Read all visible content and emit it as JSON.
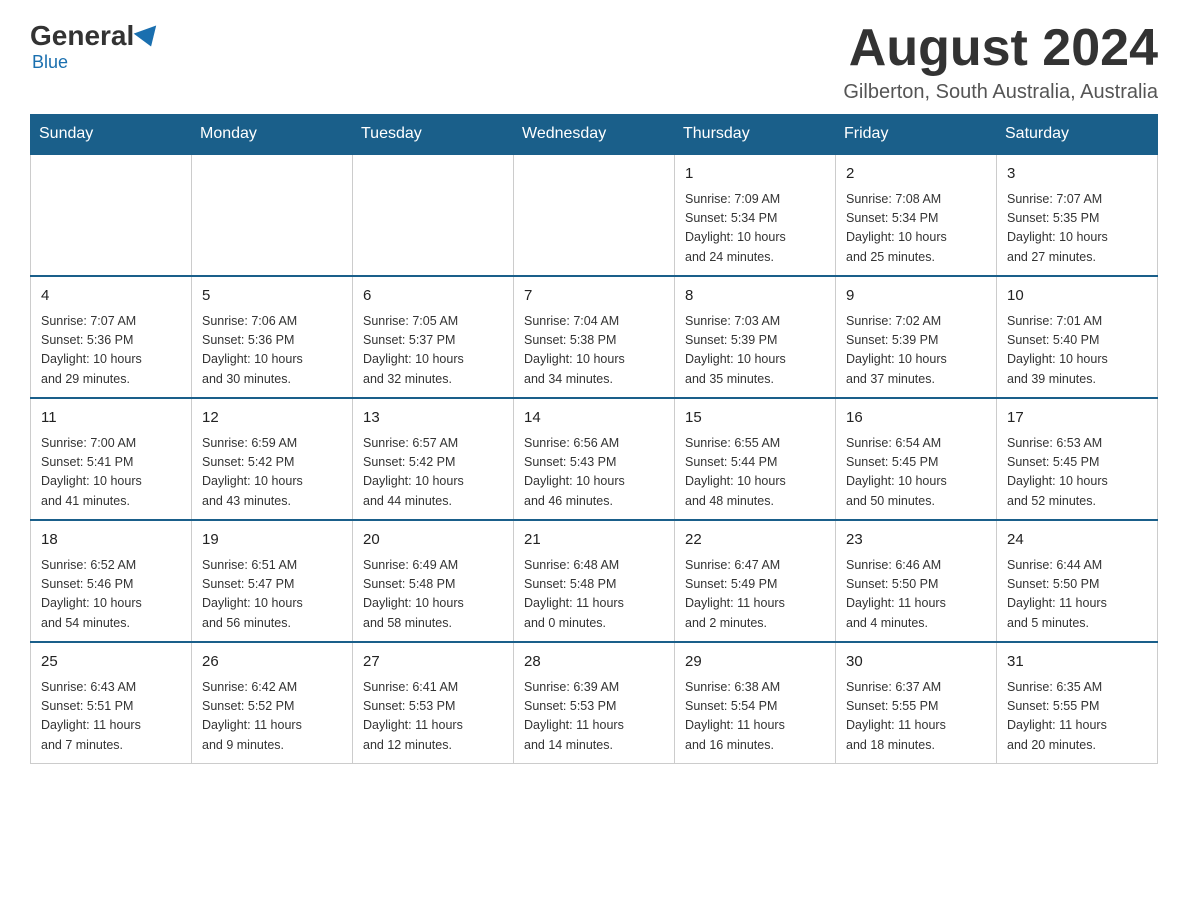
{
  "header": {
    "logo_general": "General",
    "logo_blue": "Blue",
    "month_year": "August 2024",
    "location": "Gilberton, South Australia, Australia"
  },
  "days_of_week": [
    "Sunday",
    "Monday",
    "Tuesday",
    "Wednesday",
    "Thursday",
    "Friday",
    "Saturday"
  ],
  "weeks": [
    [
      {
        "day": "",
        "info": ""
      },
      {
        "day": "",
        "info": ""
      },
      {
        "day": "",
        "info": ""
      },
      {
        "day": "",
        "info": ""
      },
      {
        "day": "1",
        "info": "Sunrise: 7:09 AM\nSunset: 5:34 PM\nDaylight: 10 hours\nand 24 minutes."
      },
      {
        "day": "2",
        "info": "Sunrise: 7:08 AM\nSunset: 5:34 PM\nDaylight: 10 hours\nand 25 minutes."
      },
      {
        "day": "3",
        "info": "Sunrise: 7:07 AM\nSunset: 5:35 PM\nDaylight: 10 hours\nand 27 minutes."
      }
    ],
    [
      {
        "day": "4",
        "info": "Sunrise: 7:07 AM\nSunset: 5:36 PM\nDaylight: 10 hours\nand 29 minutes."
      },
      {
        "day": "5",
        "info": "Sunrise: 7:06 AM\nSunset: 5:36 PM\nDaylight: 10 hours\nand 30 minutes."
      },
      {
        "day": "6",
        "info": "Sunrise: 7:05 AM\nSunset: 5:37 PM\nDaylight: 10 hours\nand 32 minutes."
      },
      {
        "day": "7",
        "info": "Sunrise: 7:04 AM\nSunset: 5:38 PM\nDaylight: 10 hours\nand 34 minutes."
      },
      {
        "day": "8",
        "info": "Sunrise: 7:03 AM\nSunset: 5:39 PM\nDaylight: 10 hours\nand 35 minutes."
      },
      {
        "day": "9",
        "info": "Sunrise: 7:02 AM\nSunset: 5:39 PM\nDaylight: 10 hours\nand 37 minutes."
      },
      {
        "day": "10",
        "info": "Sunrise: 7:01 AM\nSunset: 5:40 PM\nDaylight: 10 hours\nand 39 minutes."
      }
    ],
    [
      {
        "day": "11",
        "info": "Sunrise: 7:00 AM\nSunset: 5:41 PM\nDaylight: 10 hours\nand 41 minutes."
      },
      {
        "day": "12",
        "info": "Sunrise: 6:59 AM\nSunset: 5:42 PM\nDaylight: 10 hours\nand 43 minutes."
      },
      {
        "day": "13",
        "info": "Sunrise: 6:57 AM\nSunset: 5:42 PM\nDaylight: 10 hours\nand 44 minutes."
      },
      {
        "day": "14",
        "info": "Sunrise: 6:56 AM\nSunset: 5:43 PM\nDaylight: 10 hours\nand 46 minutes."
      },
      {
        "day": "15",
        "info": "Sunrise: 6:55 AM\nSunset: 5:44 PM\nDaylight: 10 hours\nand 48 minutes."
      },
      {
        "day": "16",
        "info": "Sunrise: 6:54 AM\nSunset: 5:45 PM\nDaylight: 10 hours\nand 50 minutes."
      },
      {
        "day": "17",
        "info": "Sunrise: 6:53 AM\nSunset: 5:45 PM\nDaylight: 10 hours\nand 52 minutes."
      }
    ],
    [
      {
        "day": "18",
        "info": "Sunrise: 6:52 AM\nSunset: 5:46 PM\nDaylight: 10 hours\nand 54 minutes."
      },
      {
        "day": "19",
        "info": "Sunrise: 6:51 AM\nSunset: 5:47 PM\nDaylight: 10 hours\nand 56 minutes."
      },
      {
        "day": "20",
        "info": "Sunrise: 6:49 AM\nSunset: 5:48 PM\nDaylight: 10 hours\nand 58 minutes."
      },
      {
        "day": "21",
        "info": "Sunrise: 6:48 AM\nSunset: 5:48 PM\nDaylight: 11 hours\nand 0 minutes."
      },
      {
        "day": "22",
        "info": "Sunrise: 6:47 AM\nSunset: 5:49 PM\nDaylight: 11 hours\nand 2 minutes."
      },
      {
        "day": "23",
        "info": "Sunrise: 6:46 AM\nSunset: 5:50 PM\nDaylight: 11 hours\nand 4 minutes."
      },
      {
        "day": "24",
        "info": "Sunrise: 6:44 AM\nSunset: 5:50 PM\nDaylight: 11 hours\nand 5 minutes."
      }
    ],
    [
      {
        "day": "25",
        "info": "Sunrise: 6:43 AM\nSunset: 5:51 PM\nDaylight: 11 hours\nand 7 minutes."
      },
      {
        "day": "26",
        "info": "Sunrise: 6:42 AM\nSunset: 5:52 PM\nDaylight: 11 hours\nand 9 minutes."
      },
      {
        "day": "27",
        "info": "Sunrise: 6:41 AM\nSunset: 5:53 PM\nDaylight: 11 hours\nand 12 minutes."
      },
      {
        "day": "28",
        "info": "Sunrise: 6:39 AM\nSunset: 5:53 PM\nDaylight: 11 hours\nand 14 minutes."
      },
      {
        "day": "29",
        "info": "Sunrise: 6:38 AM\nSunset: 5:54 PM\nDaylight: 11 hours\nand 16 minutes."
      },
      {
        "day": "30",
        "info": "Sunrise: 6:37 AM\nSunset: 5:55 PM\nDaylight: 11 hours\nand 18 minutes."
      },
      {
        "day": "31",
        "info": "Sunrise: 6:35 AM\nSunset: 5:55 PM\nDaylight: 11 hours\nand 20 minutes."
      }
    ]
  ]
}
